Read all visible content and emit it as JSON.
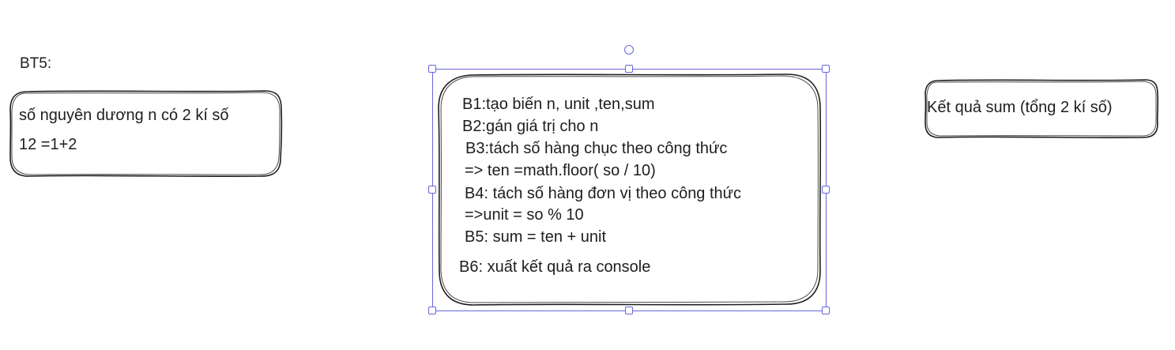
{
  "heading": {
    "text": "BT5:"
  },
  "input_box": {
    "lines": [
      "số nguyên dương n có 2 kí số",
      " 12 =1+2"
    ]
  },
  "steps_box": {
    "lines": [
      "B1:tạo biến n, unit ,ten,sum",
      "B2:gán giá trị cho n",
      "B3:tách số hàng chục theo công thức",
      "=> ten =math.floor( so / 10)",
      "B4: tách số hàng đơn vị theo công thức",
      "=>unit = so % 10",
      "B5: sum = ten + unit",
      "B6: xuất kết quả ra console"
    ]
  },
  "output_box": {
    "lines": [
      "Kết quả sum (tổng 2 kí số)"
    ]
  },
  "colors": {
    "stroke": "#1e1e1e",
    "selection": "#6965db",
    "background": "#ffffff"
  }
}
